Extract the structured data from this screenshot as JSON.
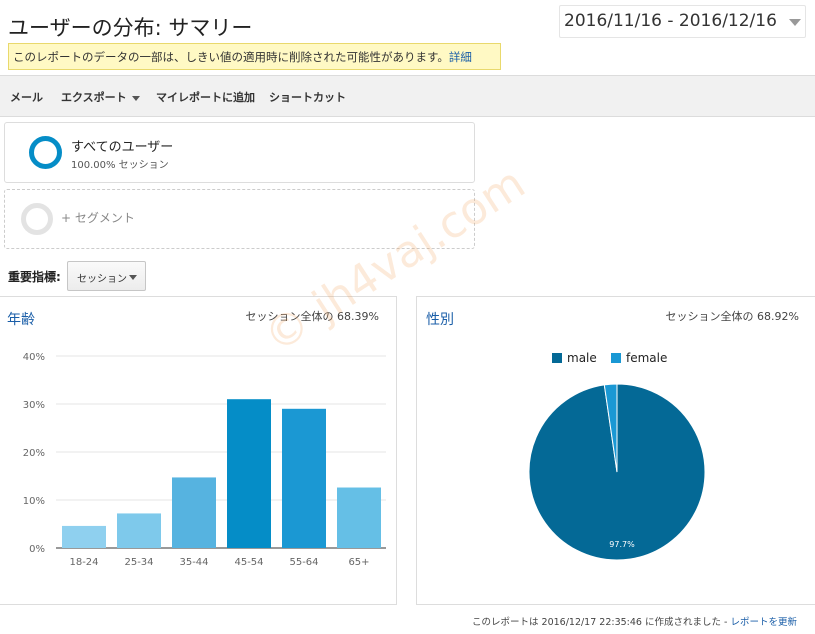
{
  "header": {
    "title": "ユーザーの分布: サマリー",
    "date_range": "2016/11/16 - 2016/12/16"
  },
  "notice": {
    "text": "このレポートのデータの一部は、しきい値の適用時に削除された可能性があります。",
    "link": "詳細"
  },
  "toolbar": {
    "email": "メール",
    "export": "エクスポート",
    "add_to_dashboard": "マイレポートに追加",
    "shortcut": "ショートカット"
  },
  "segments": {
    "active_name": "すべてのユーザー",
    "active_share": "100.00% セッション",
    "add_label": "+ セグメント"
  },
  "metric": {
    "label": "重要指標:",
    "selected": "セッション"
  },
  "age_panel": {
    "title": "年齢",
    "share": "セッション全体の 68.39%"
  },
  "gender_panel": {
    "title": "性別",
    "share": "セッション全体の 68.92%"
  },
  "footer": {
    "text": "このレポートは 2016/12/17 22:35:46 に作成されました - ",
    "link": "レポートを更新"
  },
  "watermark": "© jh4vaj.com",
  "colors": {
    "accent": "#058dc7",
    "link": "#1a5ea8"
  },
  "chart_data": [
    {
      "type": "bar",
      "categories": [
        "18-24",
        "25-34",
        "35-44",
        "45-54",
        "55-64",
        "65+"
      ],
      "values": [
        4.6,
        7.2,
        14.7,
        31.0,
        29.0,
        12.6
      ],
      "colors": [
        "#8fd0ef",
        "#7ec9eb",
        "#56b3e0",
        "#058dc7",
        "#1b98d3",
        "#65bfe6"
      ],
      "y_ticks": [
        "0%",
        "10%",
        "20%",
        "30%",
        "40%"
      ],
      "ylim": [
        0,
        40
      ],
      "grid": true
    },
    {
      "type": "pie",
      "labels": [
        "male",
        "female"
      ],
      "values": [
        97.7,
        2.3
      ],
      "colors": [
        "#046996",
        "#1a98d4"
      ],
      "slice_label": "97.7%",
      "legend": "top"
    }
  ]
}
